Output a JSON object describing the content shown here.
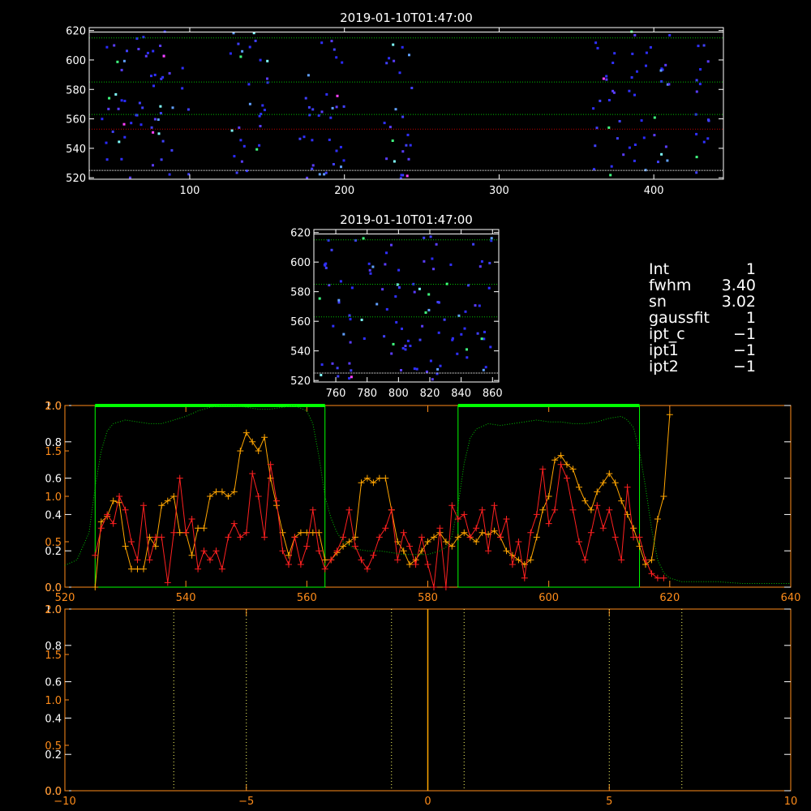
{
  "panels": {
    "top": {
      "title": "2019-01-10T01:47:00"
    },
    "middle": {
      "title": "2019-01-10T01:47:00"
    }
  },
  "info": [
    {
      "key": "Int",
      "value": "1"
    },
    {
      "key": "fwhm",
      "value": "3.40"
    },
    {
      "key": "sn",
      "value": "3.02"
    },
    {
      "key": "gaussfit",
      "value": "1"
    },
    {
      "key": "ipt_c",
      "value": "−1"
    },
    {
      "key": "ipt1",
      "value": "−1"
    },
    {
      "key": "ipt2",
      "value": "−1"
    }
  ],
  "colors": {
    "axis_white": "#ffffff",
    "axis_orange": "#ff8c1a",
    "series_orange": "#ffa500",
    "series_red": "#ff2020",
    "green": "#00ff00",
    "dotted_green": "#00c000",
    "dotted_red": "#c00000",
    "yellow": "#ffff66"
  },
  "chart_data": [
    {
      "type": "scatter",
      "title": "2019-01-10T01:47:00",
      "xlim": [
        35,
        445
      ],
      "ylim": [
        519,
        622
      ],
      "xticks": [
        "100",
        "200",
        "300",
        "400"
      ],
      "yticks": [
        "520",
        "540",
        "560",
        "580",
        "600",
        "620"
      ],
      "hlines_white": [
        525,
        619
      ],
      "hlines_green_dotted": [
        615,
        585,
        563
      ],
      "hlines_red_dotted": [
        553
      ],
      "point_clusters_x": [
        [
          40,
          100
        ],
        [
          125,
          150
        ],
        [
          170,
          200
        ],
        [
          225,
          245
        ],
        [
          360,
          410
        ],
        [
          425,
          435
        ]
      ]
    },
    {
      "type": "scatter",
      "title": "2019-01-10T01:47:00",
      "xlim": [
        746,
        864
      ],
      "ylim": [
        519,
        622
      ],
      "xticks": [
        "760",
        "780",
        "800",
        "820",
        "840",
        "860"
      ],
      "yticks": [
        "520",
        "540",
        "560",
        "580",
        "600",
        "620"
      ],
      "hlines_white": [
        525,
        619
      ],
      "hlines_green_dotted": [
        615,
        585,
        563
      ]
    },
    {
      "type": "line",
      "xlim": [
        520,
        640
      ],
      "xticks": [
        "520",
        "540",
        "560",
        "580",
        "600",
        "620",
        "640"
      ],
      "yticks_left_white": [
        "0.0",
        "0.2",
        "0.4",
        "0.6",
        "0.8",
        "1.0"
      ],
      "yticks_left_orange": [
        "0.0",
        "0.5",
        "1.0",
        "1.5",
        "2.0"
      ],
      "ylim_white": [
        0,
        1.0
      ],
      "ylim_orange": [
        0,
        2.0
      ],
      "green_boxes": [
        [
          525,
          563
        ],
        [
          585,
          615
        ]
      ],
      "green_box_top": 1.0,
      "series": [
        {
          "color": "orange",
          "x": [
            525,
            526,
            527,
            528,
            529,
            530,
            531,
            532,
            533,
            534,
            535,
            536,
            537,
            538,
            539,
            540,
            541,
            542,
            543,
            544,
            545,
            546,
            547,
            548,
            549,
            550,
            551,
            552,
            553,
            554,
            555,
            556,
            557,
            558,
            559,
            560,
            561,
            562,
            563,
            564,
            565,
            566,
            567,
            568,
            569,
            570,
            571,
            572,
            573,
            574,
            575,
            576,
            577,
            578,
            579,
            580,
            581,
            582,
            583,
            584,
            585,
            586,
            587,
            588,
            589,
            590,
            591,
            592,
            593,
            594,
            595,
            596,
            597,
            598,
            599,
            600,
            601,
            602,
            603,
            604,
            605,
            606,
            607,
            608,
            609,
            610,
            611,
            612,
            613,
            614,
            615,
            616,
            617,
            618,
            619,
            620
          ],
          "values": [
            0.0,
            0.72,
            0.78,
            0.95,
            0.93,
            0.45,
            0.2,
            0.2,
            0.2,
            0.55,
            0.45,
            0.9,
            0.95,
            1.0,
            0.6,
            0.6,
            0.35,
            0.65,
            0.65,
            1.0,
            1.05,
            1.05,
            1.0,
            1.05,
            1.5,
            1.7,
            1.6,
            1.5,
            1.65,
            1.2,
            0.9,
            0.6,
            0.35,
            0.55,
            0.6,
            0.6,
            0.6,
            0.6,
            0.3,
            0.3,
            0.38,
            0.45,
            0.5,
            0.55,
            1.15,
            1.2,
            1.15,
            1.2,
            1.2,
            0.85,
            0.5,
            0.4,
            0.25,
            0.3,
            0.4,
            0.5,
            0.55,
            0.6,
            0.5,
            0.45,
            0.55,
            0.6,
            0.55,
            0.5,
            0.6,
            0.58,
            0.62,
            0.55,
            0.4,
            0.35,
            0.3,
            0.25,
            0.3,
            0.55,
            0.85,
            1.0,
            1.4,
            1.45,
            1.35,
            1.3,
            1.1,
            0.95,
            0.85,
            1.05,
            1.15,
            1.25,
            1.15,
            0.95,
            0.8,
            0.65,
            0.45,
            0.25,
            0.3,
            0.75,
            1.0,
            1.9
          ]
        },
        {
          "color": "red",
          "x": [
            525,
            526,
            527,
            528,
            529,
            530,
            531,
            532,
            533,
            534,
            535,
            536,
            537,
            538,
            539,
            540,
            541,
            542,
            543,
            544,
            545,
            546,
            547,
            548,
            549,
            550,
            551,
            552,
            553,
            554,
            555,
            556,
            557,
            558,
            559,
            560,
            561,
            562,
            563,
            564,
            565,
            566,
            567,
            568,
            569,
            570,
            571,
            572,
            573,
            574,
            575,
            576,
            577,
            578,
            579,
            580,
            581,
            582,
            583,
            584,
            585,
            586,
            587,
            588,
            589,
            590,
            591,
            592,
            593,
            594,
            595,
            596,
            597,
            598,
            599,
            600,
            601,
            602,
            603,
            604,
            605,
            606,
            607,
            608,
            609,
            610,
            611,
            612,
            613,
            614,
            615,
            616,
            617,
            618,
            619
          ],
          "values": [
            0.35,
            0.65,
            0.8,
            0.7,
            1.0,
            0.85,
            0.5,
            0.3,
            0.9,
            0.3,
            0.55,
            0.55,
            0.05,
            0.6,
            1.2,
            0.6,
            0.75,
            0.2,
            0.4,
            0.3,
            0.4,
            0.2,
            0.55,
            0.7,
            0.55,
            0.6,
            1.25,
            1.0,
            0.55,
            1.35,
            0.95,
            0.4,
            0.25,
            0.55,
            0.25,
            0.45,
            0.85,
            0.4,
            0.2,
            0.3,
            0.4,
            0.55,
            0.85,
            0.45,
            0.3,
            0.2,
            0.35,
            0.55,
            0.65,
            0.85,
            0.3,
            0.6,
            0.45,
            0.25,
            0.55,
            0.25,
            0.0,
            0.65,
            0.0,
            0.9,
            0.75,
            0.8,
            0.55,
            0.65,
            0.85,
            0.4,
            0.9,
            0.55,
            0.75,
            0.25,
            0.5,
            0.1,
            0.6,
            0.8,
            1.3,
            0.7,
            0.85,
            1.35,
            1.2,
            0.85,
            0.5,
            0.3,
            0.6,
            0.9,
            0.65,
            0.85,
            0.55,
            0.3,
            1.1,
            0.55,
            0.55,
            0.3,
            0.15,
            0.1,
            0.1
          ]
        },
        {
          "color": "dotted-green",
          "x": [
            520,
            522,
            524,
            525,
            526,
            527,
            528,
            529,
            530,
            532,
            534,
            536,
            538,
            540,
            542,
            544,
            546,
            548,
            550,
            552,
            554,
            556,
            558,
            560,
            561,
            562,
            563,
            564,
            565,
            566,
            568,
            570,
            572,
            574,
            576,
            578,
            580,
            582,
            583,
            584,
            585,
            586,
            587,
            588,
            590,
            592,
            594,
            596,
            598,
            600,
            602,
            604,
            606,
            608,
            610,
            612,
            613,
            614,
            615,
            616,
            617,
            618,
            619,
            620,
            621,
            622,
            624,
            628,
            632,
            636,
            640
          ],
          "values": [
            0.12,
            0.15,
            0.3,
            0.55,
            0.75,
            0.86,
            0.9,
            0.91,
            0.92,
            0.91,
            0.9,
            0.9,
            0.92,
            0.94,
            0.97,
            0.99,
            1.0,
            1.0,
            0.99,
            0.98,
            0.98,
            0.99,
            1.0,
            0.97,
            0.9,
            0.72,
            0.5,
            0.38,
            0.3,
            0.25,
            0.21,
            0.2,
            0.2,
            0.19,
            0.18,
            0.18,
            0.18,
            0.2,
            0.22,
            0.28,
            0.45,
            0.68,
            0.82,
            0.87,
            0.9,
            0.89,
            0.9,
            0.91,
            0.92,
            0.91,
            0.91,
            0.9,
            0.9,
            0.91,
            0.93,
            0.94,
            0.92,
            0.88,
            0.75,
            0.55,
            0.32,
            0.15,
            0.08,
            0.05,
            0.04,
            0.03,
            0.03,
            0.03,
            0.02,
            0.02,
            0.02
          ]
        }
      ]
    },
    {
      "type": "line",
      "xlim": [
        -10,
        10
      ],
      "xticks": [
        "−10",
        "−5",
        "0",
        "5",
        "10"
      ],
      "yticks_left_white": [
        "0.0",
        "0.2",
        "0.4",
        "0.6",
        "0.8",
        "1.0"
      ],
      "yticks_left_orange": [
        "0.0",
        "0.5",
        "1.0",
        "1.5",
        "2.0"
      ],
      "vlines_yellow_dotted": [
        -7,
        -5,
        -1,
        1,
        5,
        7
      ],
      "vlines_orange_solid": [
        0
      ]
    }
  ]
}
